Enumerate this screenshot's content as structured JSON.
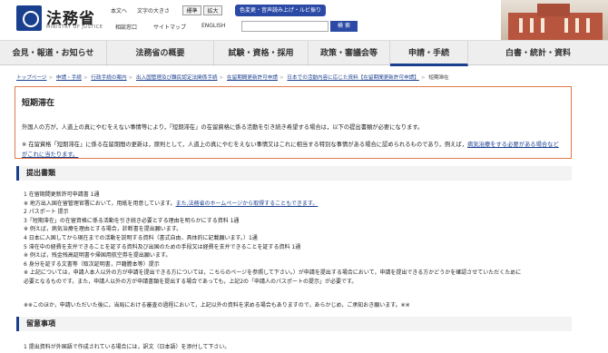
{
  "header": {
    "ministry_name": "法務省",
    "ministry_sub": "MINISTRY OF JUSTICE",
    "links": [
      "本文へ",
      "文字の大きさ",
      "標準",
      "拡大"
    ],
    "ruby_button": "色変更・音声読み上げ・ルビ振り",
    "row2_links": [
      "相談窓口",
      "サイトマップ",
      "ENGLISH"
    ],
    "search_placeholder": "",
    "search_button": "検 索"
  },
  "gnav": [
    "会見・報道・お知らせ",
    "法務省の概要",
    "試験・資格・採用",
    "政策・審議会等",
    "申請・手続",
    "白書・統計・資料"
  ],
  "breadcrumb": [
    "トップページ",
    "申請・手続",
    "行政手続の案内",
    "出入国管理及び難民認定法関係手続",
    "在留期間更新許可申請",
    "日本での活動内容に応じた資料【在留期間更新許可申請】",
    "短期滞在"
  ],
  "notice_box": {
    "title": "短期滞在",
    "text": "外国人の方が，人道上の真にやむをえない事情等により，「短期滞在」の在留資格に係る活動を引き続き希望する場合は，以下の提出書類が必要になります。",
    "note_prefix": "※ 在留資格「短期滞在」に係る在留期間の更新は，原則として，人道上の真にやむをえない事情又はこれに相当する特別な事情がある場合に認められるものであり，例えば，",
    "note_link": "病気治療をする必要がある場合などがこれに当たります。"
  },
  "sections": {
    "documents_title": "提出書類",
    "notes_title": "留意事項"
  },
  "documents": [
    "1 在留期間更新許可申請書 1通",
    "※ 地方出入国在留管理官署において，用紙を用意しています。",
    "2 パスポート 提示",
    "3「短期滞在」の在留資格に係る活動を引き続き必要とする理由を明らかにする資料 1通",
    "※ 例えば，病気治療を理由とする場合，診断書を提出願います。",
    "4 日本に入国してから現在までの活動を説明する資料（書式自由，具体的に記載願います。）1通",
    "5 滞在中の経費を支弁できることを証する資料及び出国のための手段又は経費を支弁できることを証する資料 1通",
    "※ 例えば，残金残高証明書や帰国用航空券を提出願います。",
    "6 身分を証する文書等（取次証明書，戸籍謄本等）提示",
    "※ 上記については，申請人本人以外の方が申請を提出できる方については，こちらのページを参照して下さい。）が申請を提出する場合において，申請を提出できる方かどうかを確認させていただくために",
    "必要となるものです。また，申請人以外の方が申請書類を提出する場合であっても，上記2の「申請人のパスポートの提示」が必要です。"
  ],
  "documents_link": "また,法務省のホームページから取得することもできます。",
  "closing": "※※このほか，申請いただいた後に，当局における審査の過程において，上記以外の資料を求める場合もありますので，あらかじめ，ご承知おき願います。※※",
  "notes": [
    "1 提出資料が外国語で作成されている場合には，訳文（日本語）を添付して下さい。"
  ],
  "colors": {
    "accent": "#1a3f8f",
    "box_border": "#e07a4a"
  }
}
